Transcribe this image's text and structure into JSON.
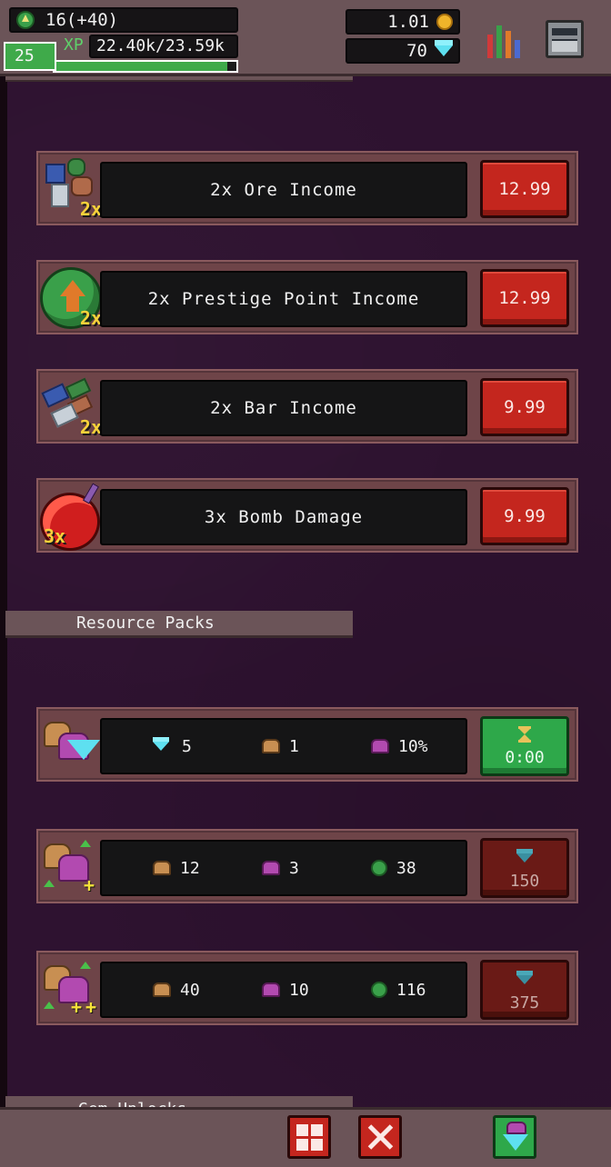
{
  "hud": {
    "prestige_points": "16(+40)",
    "level": "25",
    "xp_label": "XP",
    "xp_value": "22.40k/23.59k",
    "xp_progress": 0.95,
    "gold": "1.01",
    "gems": "70",
    "icons": {
      "prestige": "prestige-point-icon",
      "gold": "gold-coin-icon",
      "gem": "gem-icon",
      "stats": "stats-chart-icon",
      "menu": "settings-menu-icon"
    }
  },
  "boosts": [
    {
      "label": "2x Ore Income",
      "price": "12.99",
      "multiplier": "2x",
      "icon": "ore-icon"
    },
    {
      "label": "2x Prestige Point Income",
      "price": "12.99",
      "multiplier": "2x",
      "icon": "prestige-icon"
    },
    {
      "label": "2x Bar Income",
      "price": "9.99",
      "multiplier": "2x",
      "icon": "bar-icon"
    },
    {
      "label": "3x Bomb Damage",
      "price": "9.99",
      "multiplier": "3x",
      "icon": "bomb-icon"
    }
  ],
  "resource_packs": {
    "title": "Resource Packs",
    "packs": [
      {
        "items": [
          {
            "icon": "gem-icon",
            "value": "5"
          },
          {
            "icon": "chest-icon",
            "value": "1"
          },
          {
            "icon": "purple-chest-icon",
            "value": "10%"
          }
        ],
        "button_type": "timer",
        "button_text": "0:00",
        "button_icon": "hourglass-icon"
      },
      {
        "items": [
          {
            "icon": "chest-icon",
            "value": "12"
          },
          {
            "icon": "purple-chest-icon",
            "value": "3"
          },
          {
            "icon": "prestige-point-icon",
            "value": "38"
          }
        ],
        "button_type": "gems",
        "button_text": "150",
        "button_icon": "gem-icon"
      },
      {
        "items": [
          {
            "icon": "chest-icon",
            "value": "40"
          },
          {
            "icon": "purple-chest-icon",
            "value": "10"
          },
          {
            "icon": "prestige-point-icon",
            "value": "116"
          }
        ],
        "button_type": "gems",
        "button_text": "375",
        "button_icon": "gem-icon"
      }
    ]
  },
  "next_section": {
    "title": "Gem Unlocks"
  },
  "bottom_nav": [
    {
      "name": "grid-menu-button",
      "icon": "grid-icon"
    },
    {
      "name": "close-button",
      "icon": "close-icon"
    },
    {
      "name": "shop-button",
      "icon": "shop-gem-chest-icon"
    }
  ],
  "colors": {
    "background": "#2e1230",
    "panel": "#6b5458",
    "price_red": "#c4261e",
    "timer_green": "#2ea84a",
    "disabled_price": "#6a1a16",
    "accent_yellow": "#f7d23a"
  }
}
